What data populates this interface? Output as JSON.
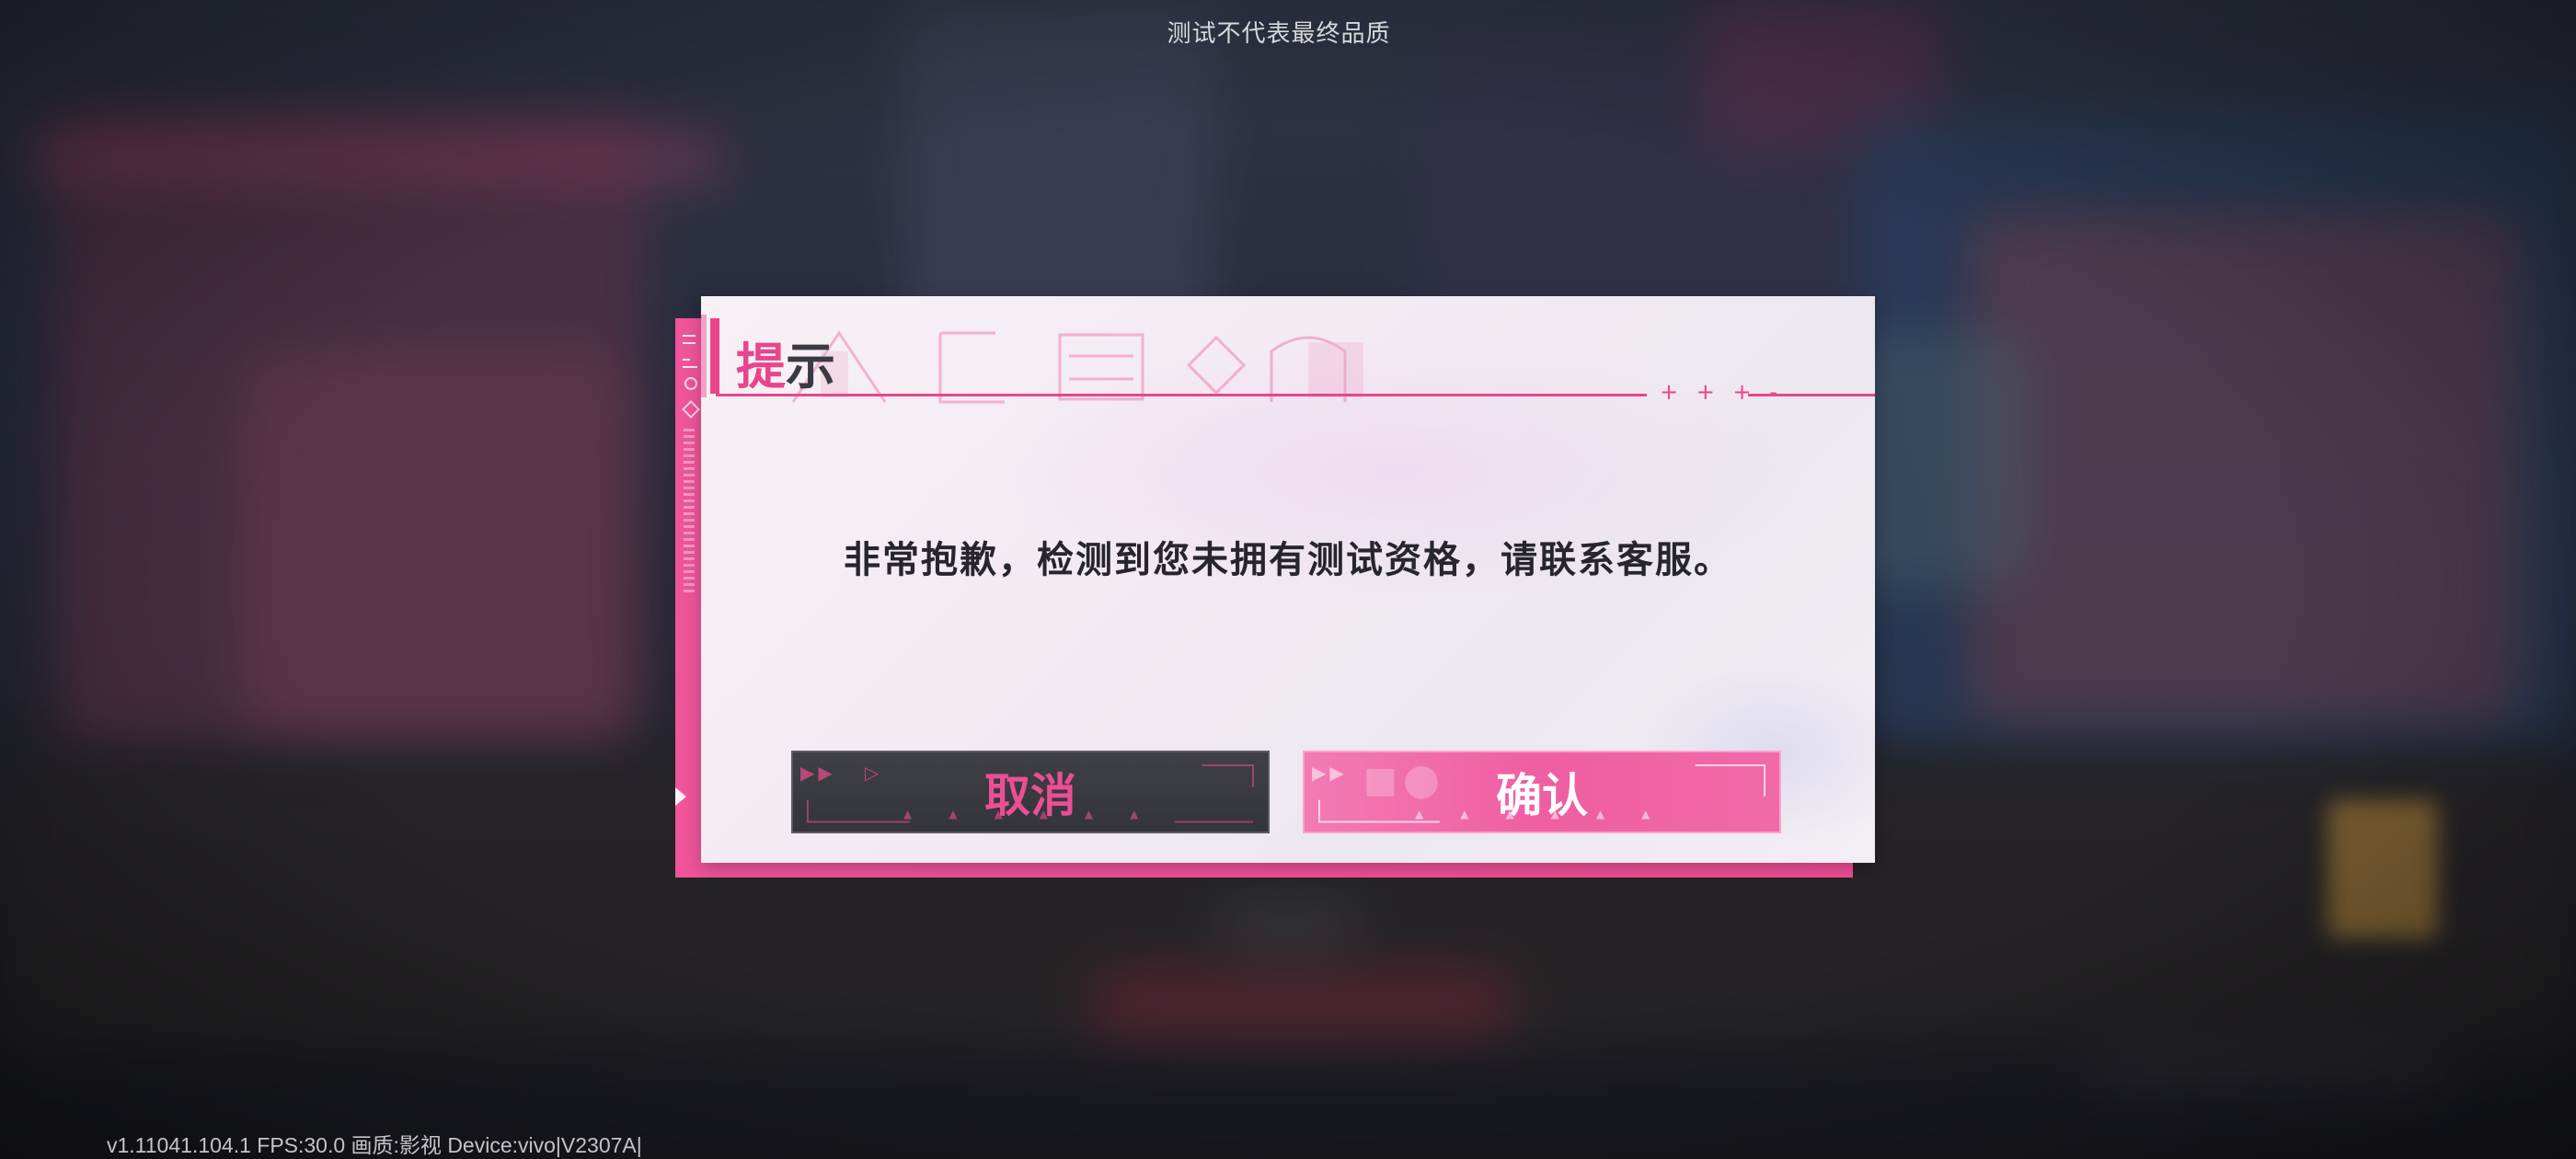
{
  "watermark": "测试不代表最终品质",
  "dialog": {
    "title_accent": "提",
    "title_rest": "示",
    "message": "非常抱歉，检测到您未拥有测试资格，请联系客服。",
    "title_stars": "+ +  + -",
    "cancel_label": "取消",
    "confirm_label": "确认"
  },
  "status_bar": "v1.11041.104.1 FPS:30.0 画质:影视 Device:vivo|V2307A|",
  "colors": {
    "accent_pink": "#e9458d",
    "cancel_bg": "#3a3a40",
    "confirm_bg": "#f06aa8",
    "dialog_bg": "#f4eef3"
  },
  "icons": [
    "triangle-play-icon",
    "sidebar-deco-icon"
  ]
}
